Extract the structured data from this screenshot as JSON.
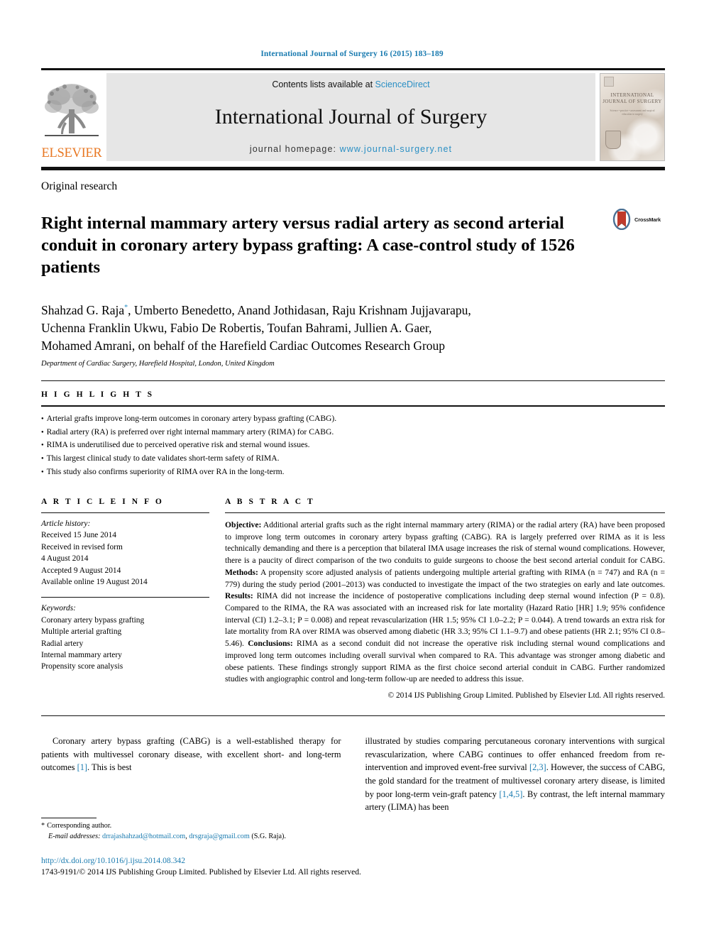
{
  "running_head": "International Journal of Surgery 16 (2015) 183–189",
  "masthead": {
    "publisher_name": "ELSEVIER",
    "contents_prefix": "Contents lists available at ",
    "sciencedirect": "ScienceDirect",
    "journal_name": "International Journal of Surgery",
    "homepage_prefix": "journal homepage: ",
    "homepage_url": "www.journal-surgery.net",
    "cover_title": "INTERNATIONAL JOURNAL OF SURGERY",
    "cover_subtitle": "Science • practice • assessment and surgical education in surgery"
  },
  "article_type": "Original research",
  "title": "Right internal mammary artery versus radial artery as second arterial conduit in coronary artery bypass grafting: A case-control study of 1526 patients",
  "crossmark_label": "CrossMark",
  "authors": "Shahzad G. Raja*, Umberto Benedetto, Anand Jothidasan, Raju Krishnam Jujjavarapu, Uchenna Franklin Ukwu, Fabio De Robertis, Toufan Bahrami, Jullien A. Gaer, Mohamed Amrani, on behalf of the Harefield Cardiac Outcomes Research Group",
  "authors_line1_a": "Shahzad G. Raja",
  "authors_line1_b": ", Umberto Benedetto, Anand Jothidasan, Raju Krishnam Jujjavarapu,",
  "authors_line2": "Uchenna Franklin Ukwu, Fabio De Robertis, Toufan Bahrami, Jullien A. Gaer,",
  "authors_line3": "Mohamed Amrani, on behalf of the Harefield Cardiac Outcomes Research Group",
  "affiliation": "Department of Cardiac Surgery, Harefield Hospital, London, United Kingdom",
  "highlights": {
    "heading": "H I G H L I G H T S",
    "items": [
      "Arterial grafts improve long-term outcomes in coronary artery bypass grafting (CABG).",
      "Radial artery (RA) is preferred over right internal mammary artery (RIMA) for CABG.",
      "RIMA is underutilised due to perceived operative risk and sternal wound issues.",
      "This largest clinical study to date validates short-term safety of RIMA.",
      "This study also confirms superiority of RIMA over RA in the long-term."
    ]
  },
  "article_info": {
    "heading": "A R T I C L E   I N F O",
    "history_label": "Article history:",
    "history": [
      "Received 15 June 2014",
      "Received in revised form",
      "4 August 2014",
      "Accepted 9 August 2014",
      "Available online 19 August 2014"
    ],
    "keywords_label": "Keywords:",
    "keywords": [
      "Coronary artery bypass grafting",
      "Multiple arterial grafting",
      "Radial artery",
      "Internal mammary artery",
      "Propensity score analysis"
    ]
  },
  "abstract": {
    "heading": "A B S T R A C T",
    "objective_label": "Objective:",
    "objective_text": " Additional arterial grafts such as the right internal mammary artery (RIMA) or the radial artery (RA) have been proposed to improve long term outcomes in coronary artery bypass grafting (CABG). RA is largely preferred over RIMA as it is less technically demanding and there is a perception that bilateral IMA usage increases the risk of sternal wound complications. However, there is a paucity of direct comparison of the two conduits to guide surgeons to choose the best second arterial conduit for CABG. ",
    "methods_label": "Methods:",
    "methods_text": " A propensity score adjusted analysis of patients undergoing multiple arterial grafting with RIMA (n = 747) and RA (n = 779) during the study period (2001–2013) was conducted to investigate the impact of the two strategies on early and late outcomes. ",
    "results_label": "Results:",
    "results_text": " RIMA did not increase the incidence of postoperative complications including deep sternal wound infection (P = 0.8). Compared to the RIMA, the RA was associated with an increased risk for late mortality (Hazard Ratio [HR] 1.9; 95% confidence interval (CI) 1.2–3.1; P = 0.008) and repeat revascularization (HR 1.5; 95% CI 1.0–2.2; P = 0.044). A trend towards an extra risk for late mortality from RA over RIMA was observed among diabetic (HR 3.3; 95% CI 1.1–9.7) and obese patients (HR 2.1; 95% CI 0.8–5.46). ",
    "conclusions_label": "Conclusions:",
    "conclusions_text": " RIMA as a second conduit did not increase the operative risk including sternal wound complications and improved long term outcomes including overall survival when compared to RA. This advantage was stronger among diabetic and obese patients. These findings strongly support RIMA as the first choice second arterial conduit in CABG. Further randomized studies with angiographic control and long-term follow-up are needed to address this issue.",
    "copyright": "© 2014 IJS Publishing Group Limited. Published by Elsevier Ltd. All rights reserved."
  },
  "body": {
    "left_paragraph": "Coronary artery bypass grafting (CABG) is a well-established therapy for patients with multivessel coronary disease, with excellent short- and long-term outcomes ",
    "left_ref": "[1]",
    "left_tail": ". This is best",
    "right_part1": "illustrated by studies comparing percutaneous coronary interventions with surgical revascularization, where CABG continues to offer enhanced freedom from re-intervention and improved event-free survival ",
    "right_ref1": "[2,3]",
    "right_part2": ". However, the success of CABG, the gold standard for the treatment of multivessel coronary artery disease, is limited by poor long-term vein-graft patency ",
    "right_ref2": "[1,4,5]",
    "right_part3": ". By contrast, the left internal mammary artery (LIMA) has been"
  },
  "footnote": {
    "corresponding": "Corresponding author.",
    "email_label": "E-mail addresses:",
    "email1": "drrajashahzad@hotmail.com",
    "email_sep": ", ",
    "email2": "drsgraja@gmail.com",
    "email_owner": " (S.G. Raja)."
  },
  "bottom": {
    "doi": "http://dx.doi.org/10.1016/j.ijsu.2014.08.342",
    "issn": "1743-9191/© 2014 IJS Publishing Group Limited. Published by Elsevier Ltd. All rights reserved."
  },
  "colors": {
    "link_blue": "#1a7bb0",
    "sciencedirect_blue": "#2a8fc4",
    "elsevier_orange": "#E87722",
    "crossmark_red": "#c0392b",
    "crossmark_blue": "#3b5c7e"
  }
}
